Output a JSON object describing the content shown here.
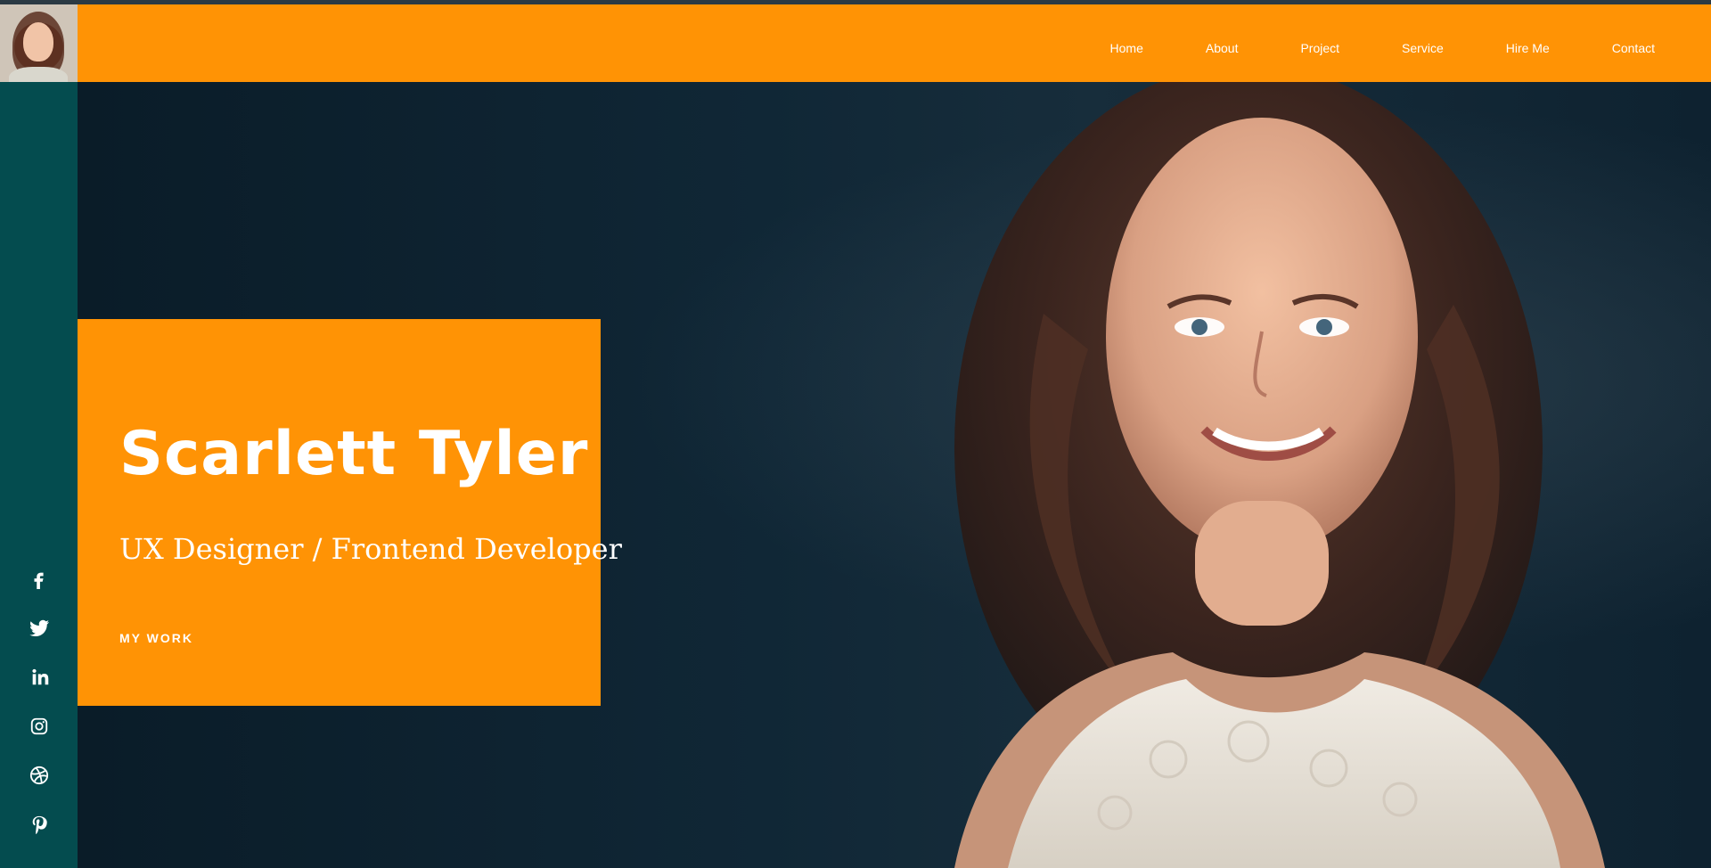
{
  "header": {
    "nav": [
      "Home",
      "About",
      "Project",
      "Service",
      "Hire Me",
      "Contact"
    ],
    "avatar": "profile-photo"
  },
  "sidebar": {
    "social_icons": [
      "facebook-icon",
      "twitter-icon",
      "linkedin-icon",
      "instagram-icon",
      "dribbble-icon",
      "pinterest-icon"
    ]
  },
  "hero": {
    "name": "Scarlett Tyler",
    "role": "UX Designer / Frontend Developer",
    "cta": "MY WORK"
  },
  "colors": {
    "accent": "#ff9305",
    "sidebar": "#044c4f",
    "background": "#0c1e2b"
  }
}
